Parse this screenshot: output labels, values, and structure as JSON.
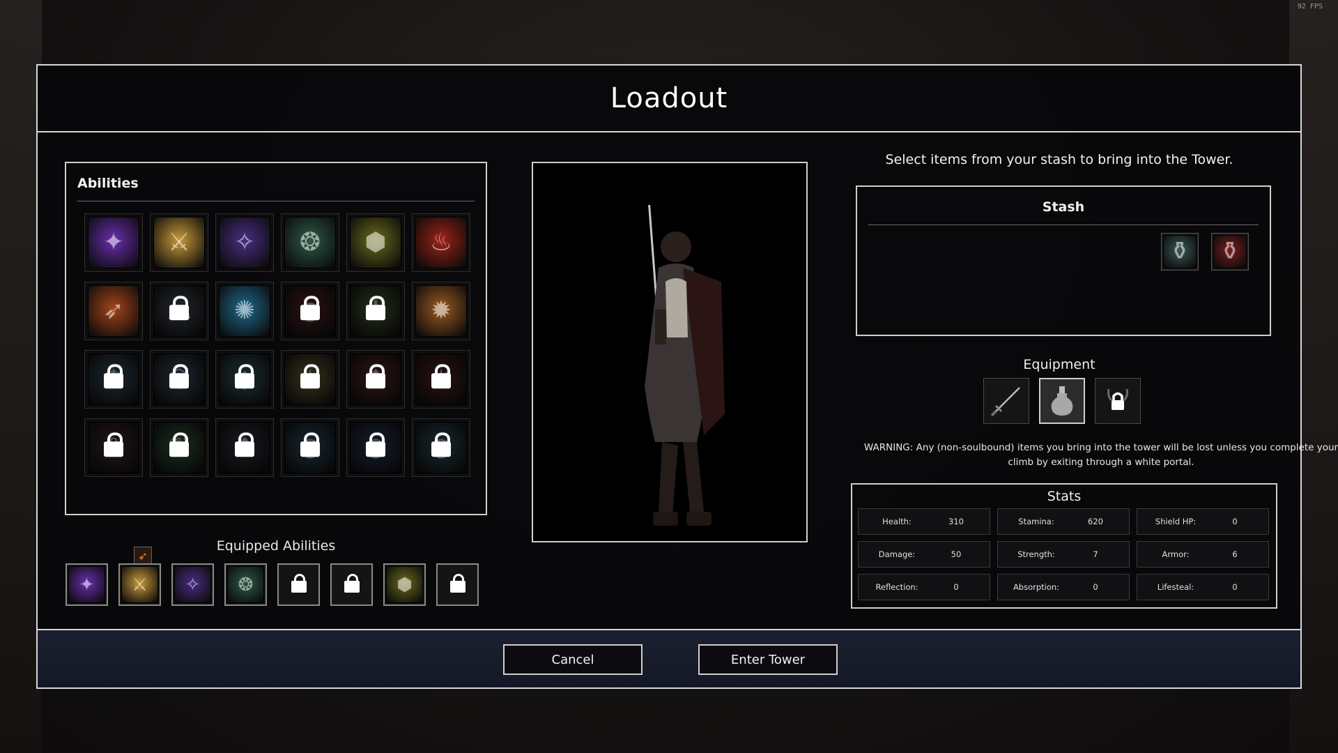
{
  "fps": "92 FPS",
  "title": "Loadout",
  "abilities": {
    "label": "Abilities",
    "grid": [
      {
        "icon": "arcane-figure-icon",
        "color": "#6a2fb0",
        "glyph": "✦",
        "locked": false
      },
      {
        "icon": "radiant-blade-icon",
        "color": "#c89a3a",
        "glyph": "⚔",
        "locked": false
      },
      {
        "icon": "shadow-mage-icon",
        "color": "#4a2e82",
        "glyph": "✧",
        "locked": false
      },
      {
        "icon": "green-spirit-icon",
        "color": "#2f5a48",
        "glyph": "❂",
        "locked": false
      },
      {
        "icon": "golden-shield-icon",
        "color": "#6a6a1e",
        "glyph": "⬢",
        "locked": false
      },
      {
        "icon": "red-demon-icon",
        "color": "#9c2318",
        "glyph": "♨",
        "locked": false
      },
      {
        "icon": "fire-sword-icon",
        "color": "#a3461a",
        "glyph": "➶",
        "locked": false
      },
      {
        "icon": "ghost-icon",
        "color": "#3a4658",
        "glyph": "☁",
        "locked": true
      },
      {
        "icon": "ice-shard-icon",
        "color": "#1f6a8c",
        "glyph": "✺",
        "locked": false
      },
      {
        "icon": "blood-orb-icon",
        "color": "#6a1a22",
        "glyph": "●",
        "locked": true
      },
      {
        "icon": "holy-cross-icon",
        "color": "#3a5a1a",
        "glyph": "✝",
        "locked": true
      },
      {
        "icon": "flame-strike-icon",
        "color": "#9c5a22",
        "glyph": "✹",
        "locked": false
      },
      {
        "icon": "frost-swirl-icon",
        "color": "#1f4f6a",
        "glyph": "❄",
        "locked": true
      },
      {
        "icon": "crystal-shield-icon",
        "color": "#2a4a6c",
        "glyph": "⬡",
        "locked": true
      },
      {
        "icon": "teal-crystal-icon",
        "color": "#225868",
        "glyph": "◆",
        "locked": true
      },
      {
        "icon": "gold-burst-icon",
        "color": "#6a5a1a",
        "glyph": "✶",
        "locked": true
      },
      {
        "icon": "red-flame-icon",
        "color": "#6a221a",
        "glyph": "♦",
        "locked": true
      },
      {
        "icon": "crimson-star-icon",
        "color": "#6a1a1f",
        "glyph": "✷",
        "locked": true
      },
      {
        "icon": "dark-rose-icon",
        "color": "#4a2232",
        "glyph": "❀",
        "locked": true
      },
      {
        "icon": "nature-leaf-icon",
        "color": "#1e5a2a",
        "glyph": "❦",
        "locked": true
      },
      {
        "icon": "violet-mist-icon",
        "color": "#3a2a48",
        "glyph": "❖",
        "locked": true
      },
      {
        "icon": "blue-vortex-icon",
        "color": "#1f4a6a",
        "glyph": "◎",
        "locked": true
      },
      {
        "icon": "azure-vortex-icon",
        "color": "#1e3a6a",
        "glyph": "◉",
        "locked": true
      },
      {
        "icon": "cyan-vortex-icon",
        "color": "#1f4f62",
        "glyph": "◍",
        "locked": true
      }
    ]
  },
  "equipped": {
    "label": "Equipped Abilities",
    "slots": [
      {
        "icon": "arcane-figure-icon",
        "color": "#6a2fb0",
        "glyph": "✦",
        "locked": false
      },
      {
        "icon": "radiant-blade-icon",
        "color": "#c89a3a",
        "glyph": "⚔",
        "locked": false
      },
      {
        "icon": "shadow-mage-icon",
        "color": "#4a2e82",
        "glyph": "✧",
        "locked": false
      },
      {
        "icon": "green-spirit-icon",
        "color": "#2f5a48",
        "glyph": "❂",
        "locked": false
      },
      {
        "icon": "lock-icon",
        "locked": true
      },
      {
        "icon": "lock-icon",
        "locked": true
      },
      {
        "icon": "golden-shield-icon",
        "color": "#6a6a1e",
        "glyph": "⬢",
        "locked": false
      },
      {
        "icon": "lock-icon",
        "locked": true
      }
    ]
  },
  "instructions": "Select items from your stash to bring into the Tower.",
  "stash": {
    "label": "Stash",
    "items": [
      {
        "icon": "teal-potion-icon",
        "color": "#3a5a58"
      },
      {
        "icon": "red-potion-icon",
        "color": "#7a1e1e"
      }
    ]
  },
  "equipment": {
    "label": "Equipment",
    "slots": [
      {
        "icon": "sword-icon",
        "selected": false
      },
      {
        "icon": "flask-icon",
        "selected": true
      },
      {
        "icon": "helmet-lock-icon",
        "selected": false
      }
    ]
  },
  "warning": "WARNING: Any (non-soulbound) items you bring into the tower will be lost unless you complete your climb by exiting through a white portal.",
  "stats": {
    "label": "Stats",
    "items": [
      {
        "name": "Health:",
        "value": "310"
      },
      {
        "name": "Stamina:",
        "value": "620"
      },
      {
        "name": "Shield HP:",
        "value": "0"
      },
      {
        "name": "Damage:",
        "value": "50"
      },
      {
        "name": "Strength:",
        "value": "7"
      },
      {
        "name": "Armor:",
        "value": "6"
      },
      {
        "name": "Reflection:",
        "value": "0"
      },
      {
        "name": "Absorption:",
        "value": "0"
      },
      {
        "name": "Lifesteal:",
        "value": "0"
      }
    ]
  },
  "buttons": {
    "cancel": "Cancel",
    "enter": "Enter Tower"
  }
}
